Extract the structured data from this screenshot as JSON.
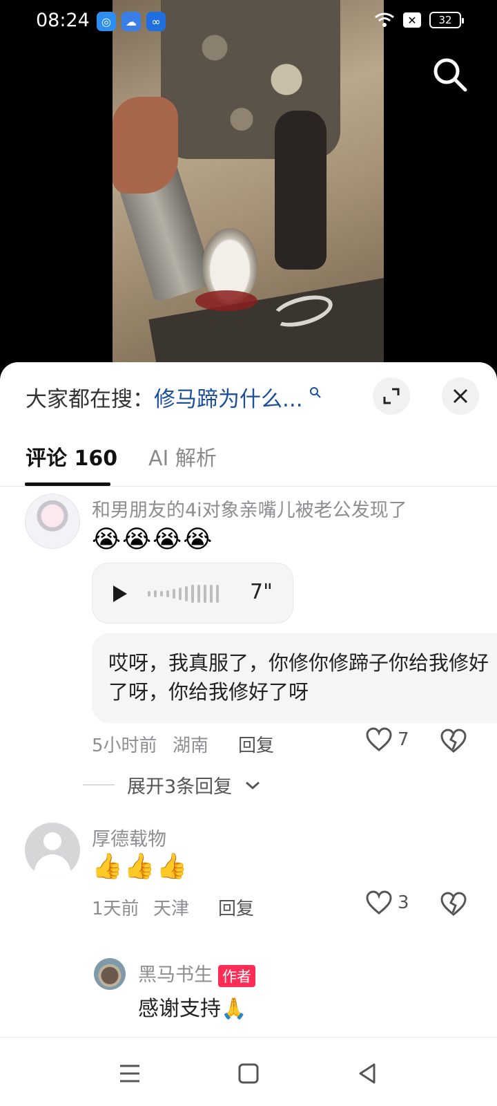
{
  "status_bar": {
    "time": "08:24",
    "battery": "32",
    "app_icons": [
      "qq-browser-icon",
      "weather-icon",
      "baidu-netdisk-icon"
    ]
  },
  "search_hint": {
    "prefix": "大家都在搜：",
    "keyword": "修马蹄为什么..."
  },
  "tabs": [
    {
      "label": "评论 160",
      "active": true
    },
    {
      "label": "AI 解析",
      "active": false
    }
  ],
  "comments": [
    {
      "username": "和男朋友的4i对象亲嘴儿被老公发现了",
      "emoji": "😭😭😭😭",
      "voice_duration": "7\"",
      "transcript": "哎呀，我真服了，你修你修蹄子你给我修好了呀，你给我修好了呀",
      "time": "5小时前",
      "location": "湖南",
      "reply_label": "回复",
      "likes": "7",
      "expand_replies": "展开3条回复"
    },
    {
      "username": "厚德载物",
      "emoji": "👍👍👍",
      "time": "1天前",
      "location": "天津",
      "reply_label": "回复",
      "likes": "3",
      "reply": {
        "username": "黑马书生",
        "badge": "作者",
        "text": "感谢支持🙏"
      }
    }
  ],
  "colors": {
    "keyword": "#1c4f9b",
    "author_badge": "#ff2d55",
    "sheet_bg": "#ffffff"
  }
}
